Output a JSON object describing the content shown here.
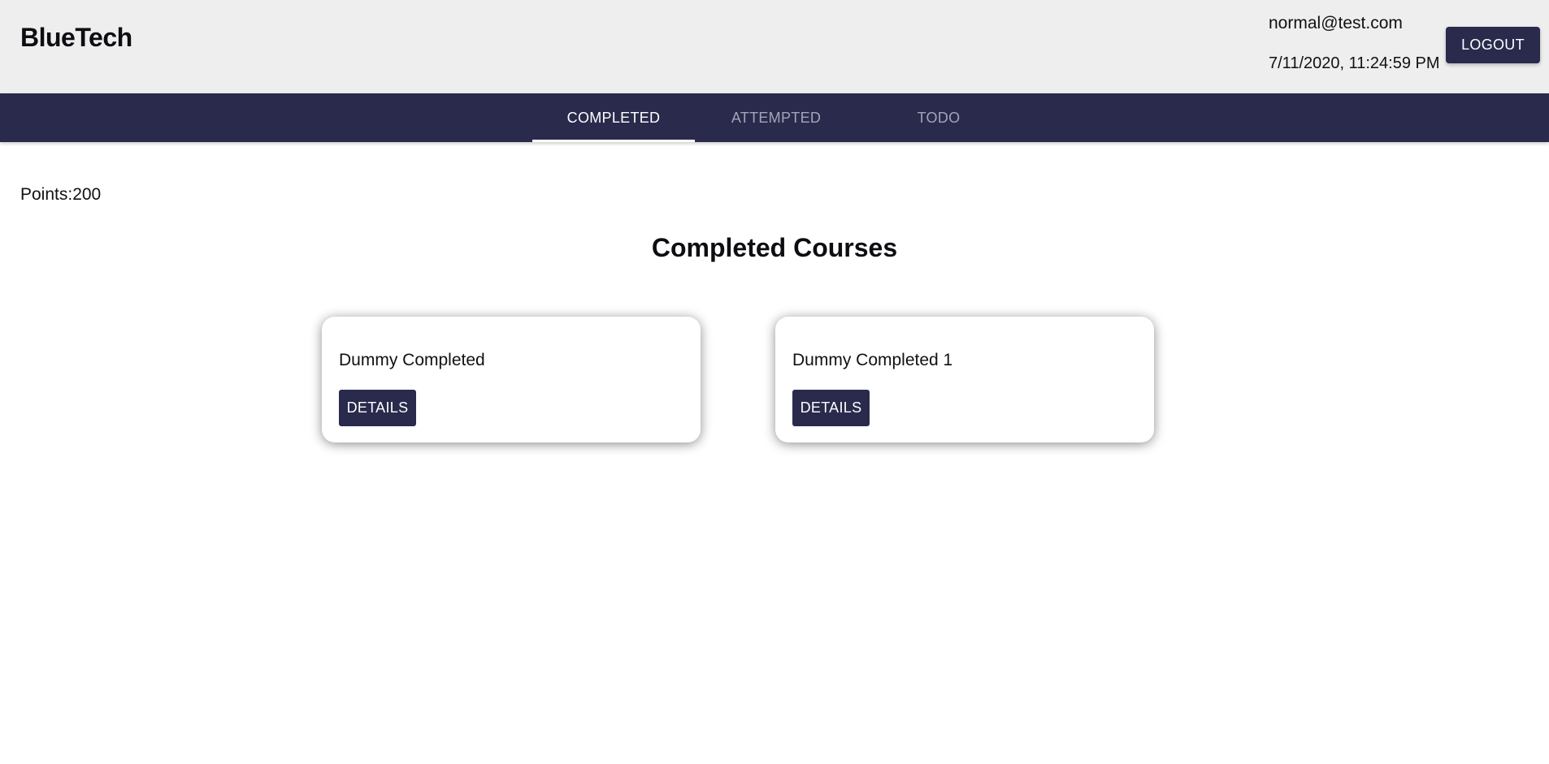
{
  "header": {
    "brand": "BlueTech",
    "user_email": "normal@test.com",
    "datetime": "7/11/2020, 11:24:59 PM",
    "logout_label": "LOGOUT"
  },
  "tabs": [
    {
      "label": "COMPLETED",
      "active": true
    },
    {
      "label": "ATTEMPTED",
      "active": false
    },
    {
      "label": "TODO",
      "active": false
    }
  ],
  "main": {
    "points": "Points:200",
    "section_title": "Completed Courses",
    "courses": [
      {
        "title": "Dummy Completed",
        "button_label": "DETAILS"
      },
      {
        "title": "Dummy Completed 1",
        "button_label": "DETAILS"
      }
    ]
  },
  "colors": {
    "header_bg": "#eeeeee",
    "primary": "#292a4c",
    "tab_inactive_text": "#a3a4b8",
    "tab_active_text": "#ffffff"
  }
}
